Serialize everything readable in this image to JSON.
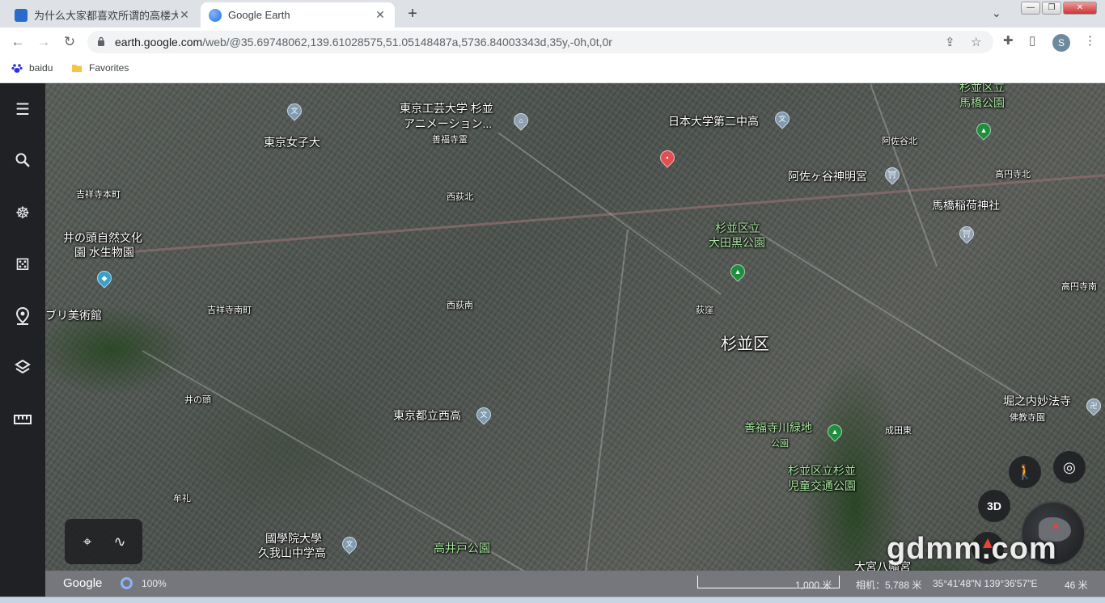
{
  "browser": {
    "tabs": [
      {
        "title": "为什么大家都喜欢所谓的高楼大厦",
        "active": false,
        "favicon_color": "#2a6acf"
      },
      {
        "title": "Google Earth",
        "active": true,
        "favicon_color": "#4285f4"
      }
    ],
    "new_tab_label": "+",
    "tab_menu_label": "⌄",
    "window_controls": {
      "minimize": "—",
      "restore": "❐",
      "close": "✕"
    },
    "url_host": "earth.google.com",
    "url_path": "/web/@35.69748062,139.61028575,51.05148487a,5736.84003343d,35y,-0h,0t,0r",
    "profile_initial": "S",
    "bookmarks": [
      {
        "label": "baidu",
        "icon": "paw-icon"
      },
      {
        "label": "Favorites",
        "icon": "folder-icon"
      }
    ]
  },
  "map": {
    "labels": [
      {
        "text": "東京女子大",
        "style": ""
      },
      {
        "text": "東京工芸大学 杉並",
        "style": ""
      },
      {
        "text": "アニメーション...",
        "style": ""
      },
      {
        "text": "善福寺霊",
        "style": "small"
      },
      {
        "text": "日本大学第二中高",
        "style": ""
      },
      {
        "text": "杉並区立",
        "style": "green"
      },
      {
        "text": "馬橋公園",
        "style": "green"
      },
      {
        "text": "阿佐谷北",
        "style": "small"
      },
      {
        "text": "阿佐ヶ谷神明宮",
        "style": ""
      },
      {
        "text": "高円寺北",
        "style": "small"
      },
      {
        "text": "馬橋稲荷神社",
        "style": ""
      },
      {
        "text": "吉祥寺本町",
        "style": "small"
      },
      {
        "text": "西荻北",
        "style": "small"
      },
      {
        "text": "井の頭自然文化",
        "style": ""
      },
      {
        "text": "園 水生物園",
        "style": ""
      },
      {
        "text": "杉並区立",
        "style": "green"
      },
      {
        "text": "大田黒公園",
        "style": "green"
      },
      {
        "text": "高円寺南",
        "style": "small"
      },
      {
        "text": "ブリ美術館",
        "style": ""
      },
      {
        "text": "吉祥寺南町",
        "style": "small"
      },
      {
        "text": "西荻南",
        "style": "small"
      },
      {
        "text": "荻窪",
        "style": "small"
      },
      {
        "text": "杉並区",
        "style": "big"
      },
      {
        "text": "井の頭",
        "style": "small"
      },
      {
        "text": "東京都立西高",
        "style": ""
      },
      {
        "text": "善福寺川緑地",
        "style": "green"
      },
      {
        "text": "公園",
        "style": "green small"
      },
      {
        "text": "成田東",
        "style": "small"
      },
      {
        "text": "堀之内妙法寺",
        "style": ""
      },
      {
        "text": "佛教寺園",
        "style": "small"
      },
      {
        "text": "杉並区立杉並",
        "style": "green"
      },
      {
        "text": "児童交通公園",
        "style": "green"
      },
      {
        "text": "牟礼",
        "style": "small"
      },
      {
        "text": "國學院大學",
        "style": ""
      },
      {
        "text": "久我山中学高",
        "style": ""
      },
      {
        "text": "高井戸公園",
        "style": "green"
      },
      {
        "text": "大宮八幡宮",
        "style": ""
      }
    ],
    "three_d_label": "3D",
    "watermark": "gdmm.com"
  },
  "status": {
    "brand": "Google",
    "zoom_pct": "100%",
    "scale_label": "1,000 米",
    "camera": "相机：5,788 米",
    "coords": "35°41'48\"N 139°36'57\"E",
    "altitude": "46 米"
  },
  "colors": {
    "sidebar_bg": "#202124",
    "accent": "#8ab4f8",
    "park_pin": "#1e8e3e"
  }
}
